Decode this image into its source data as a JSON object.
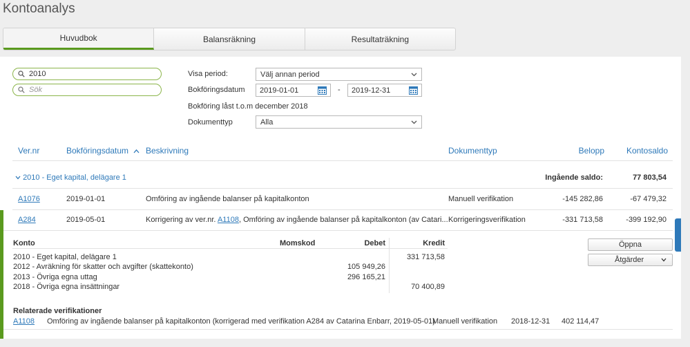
{
  "page_title": "Kontoanalys",
  "tabs": [
    {
      "label": "Huvudbok",
      "active": true
    },
    {
      "label": "Balansräkning",
      "active": false
    },
    {
      "label": "Resultaträkning",
      "active": false
    }
  ],
  "filters": {
    "search1_value": "2010",
    "search2_placeholder": "Sök",
    "period_label": "Visa period:",
    "period_value": "Välj annan period",
    "date_label": "Bokföringsdatum",
    "date_from": "2019-01-01",
    "date_sep": "-",
    "date_to": "2019-12-31",
    "locked_text": "Bokföring låst t.o.m december 2018",
    "doctype_label": "Dokumenttyp",
    "doctype_value": "Alla"
  },
  "columns": {
    "vernr": "Ver.nr",
    "date": "Bokföringsdatum",
    "desc": "Beskrivning",
    "doctype": "Dokumenttyp",
    "amount": "Belopp",
    "balance": "Kontosaldo"
  },
  "group": {
    "label": "2010 - Eget kapital, delägare 1",
    "opening_label": "Ingående saldo:",
    "opening_value": "77 803,54"
  },
  "rows": [
    {
      "ver": "A1076",
      "date": "2019-01-01",
      "desc": "Omföring av ingående balanser på kapitalkonton",
      "doctype": "Manuell verifikation",
      "amount": "-145 282,86",
      "balance": "-67 479,32"
    },
    {
      "ver": "A284",
      "date": "2019-05-01",
      "desc_pre": "Korrigering av ver.nr. ",
      "desc_link": "A1108",
      "desc_post": ", Omföring av ingående balanser på kapitalkonton (av Catari...",
      "doctype": "Korrigeringsverifikation",
      "amount": "-331 713,58",
      "balance": "-399 192,90"
    }
  ],
  "detail": {
    "headers": {
      "konto": "Konto",
      "momskod": "Momskod",
      "debet": "Debet",
      "kredit": "Kredit"
    },
    "lines": [
      {
        "konto": "2010 - Eget kapital, delägare 1",
        "debet": "",
        "kredit": "331 713,58"
      },
      {
        "konto": "2012 - Avräkning för skatter och avgifter (skattekonto)",
        "debet": "105 949,26",
        "kredit": ""
      },
      {
        "konto": "2013 - Övriga egna uttag",
        "debet": "296 165,21",
        "kredit": ""
      },
      {
        "konto": "2018 - Övriga egna insättningar",
        "debet": "",
        "kredit": "70 400,89"
      }
    ],
    "open_button": "Öppna",
    "actions_button": "Åtgärder",
    "related_title": "Relaterade verifikationer",
    "related": {
      "ver": "A1108",
      "desc": "Omföring av ingående balanser på kapitalkonton (korrigerad med verifikation A284 av Catarina Enbarr, 2019-05-01)",
      "doctype": "Manuell verifikation",
      "date": "2018-12-31",
      "amount": "402 114,47"
    }
  },
  "colors": {
    "accent": "#5a9a1e",
    "link": "#2e79b9"
  }
}
